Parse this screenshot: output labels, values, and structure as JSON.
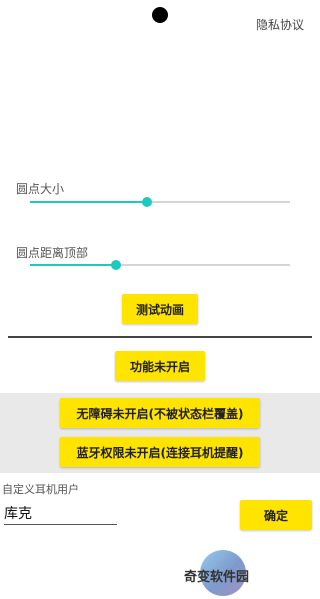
{
  "header": {
    "privacy_label": "隐私协议"
  },
  "settings": {
    "dot_size": {
      "label": "圆点大小",
      "value": 0.45
    },
    "dot_top_distance": {
      "label": "圆点距离顶部",
      "value": 0.33
    }
  },
  "buttons": {
    "test_animation": "测试动画",
    "feature_status": "功能未开启",
    "accessibility": "无障碍未开启(不被状态栏覆盖)",
    "bluetooth": "蓝牙权限未开启(连接耳机提醒)",
    "confirm": "确定"
  },
  "custom_user": {
    "label": "自定义耳机用户",
    "value": "库克"
  },
  "watermark": {
    "text": "奇变软件园"
  },
  "colors": {
    "accent": "#1ec9c0",
    "button": "#ffe400",
    "panel": "#e9e9e9"
  }
}
